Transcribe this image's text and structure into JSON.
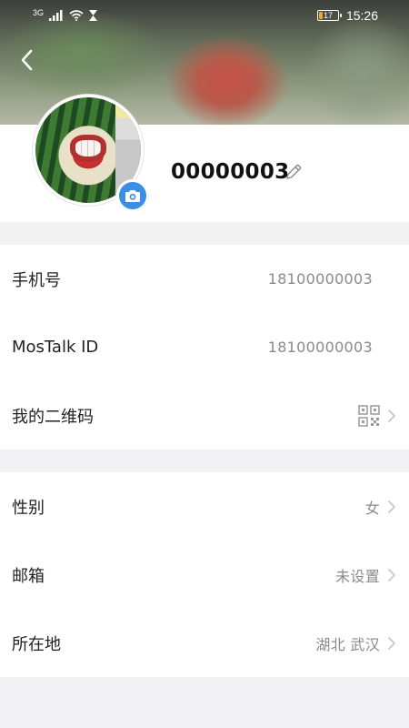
{
  "status_bar": {
    "network_label": "3G",
    "battery_level": "17",
    "time": "15:26",
    "battery_color": "#f0a530"
  },
  "header": {
    "back_icon": "chevron-left-icon"
  },
  "profile": {
    "name": "00000003",
    "camera_icon": "camera-icon",
    "edit_icon": "pencil-icon",
    "accent_color": "#3a8ee6"
  },
  "section1": {
    "phone": {
      "label": "手机号",
      "value": "18100000003"
    },
    "mostalk_id": {
      "label": "MosTalk ID",
      "value": "18100000003"
    },
    "qr_code": {
      "label": "我的二维码",
      "icon": "qr-code-icon"
    }
  },
  "section2": {
    "gender": {
      "label": "性别",
      "value": "女"
    },
    "email": {
      "label": "邮箱",
      "value": "未设置"
    },
    "location": {
      "label": "所在地",
      "value": "湖北 武汉"
    }
  }
}
